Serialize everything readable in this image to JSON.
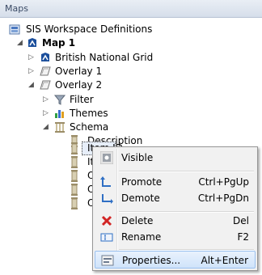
{
  "panel": {
    "title": "Maps"
  },
  "tree": {
    "root": "SIS Workspace Definitions",
    "map": "Map 1",
    "british_national_grid": "British National Grid",
    "overlay1": "Overlay 1",
    "overlay2": "Overlay 2",
    "filter": "Filter",
    "themes": "Themes",
    "schema": "Schema",
    "description": "Description",
    "item_id": "Item ID",
    "partial_items": [
      "Ite",
      "Or",
      "Or",
      "Or"
    ]
  },
  "context_menu": {
    "visible": "Visible",
    "promote": "Promote",
    "promote_shortcut": "Ctrl+PgUp",
    "demote": "Demote",
    "demote_shortcut": "Ctrl+PgDn",
    "delete": "Delete",
    "delete_shortcut": "Del",
    "rename": "Rename",
    "rename_shortcut": "F2",
    "properties": "Properties...",
    "properties_shortcut": "Alt+Enter"
  },
  "colors": {
    "selection_fill": "#cfe3fa",
    "selection_border": "#9ac0ef",
    "delete_red": "#d22525",
    "accent_blue": "#2f6fc4"
  }
}
